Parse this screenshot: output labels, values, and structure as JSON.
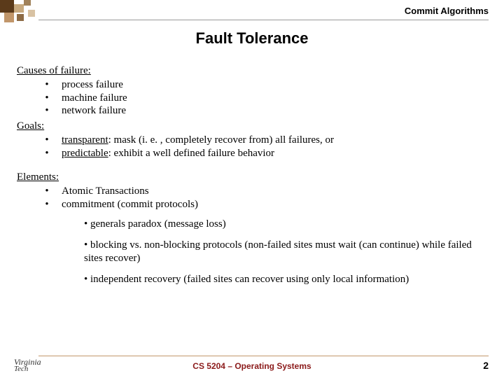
{
  "header": {
    "label": "Commit Algorithms"
  },
  "title": "Fault Tolerance",
  "sections": {
    "causes": {
      "heading": "Causes of failure:",
      "items": [
        "process failure",
        "machine failure",
        "network failure"
      ]
    },
    "goals": {
      "heading": "Goals:",
      "items": [
        {
          "term": "transparent",
          "rest": ": mask (i. e. , completely recover from) all failures, or"
        },
        {
          "term": "predictable",
          "rest": ": exhibit a well defined failure behavior"
        }
      ]
    },
    "elements": {
      "heading": "Elements:",
      "items": [
        "Atomic Transactions",
        "commitment (commit protocols)"
      ],
      "sub": [
        "• generals paradox (message loss)",
        "• blocking vs. non-blocking protocols (non-failed sites must wait (can continue) while failed sites recover)",
        "• independent recovery (failed sites can recover using only local information)"
      ]
    }
  },
  "footer": {
    "course": "CS 5204 – Operating Systems",
    "page": "2",
    "logo1": "Virginia",
    "logo2": "Tech"
  },
  "deco": {
    "c1": "#5b3a1a",
    "c2": "#c7a97e",
    "c3": "#8d6b45"
  }
}
